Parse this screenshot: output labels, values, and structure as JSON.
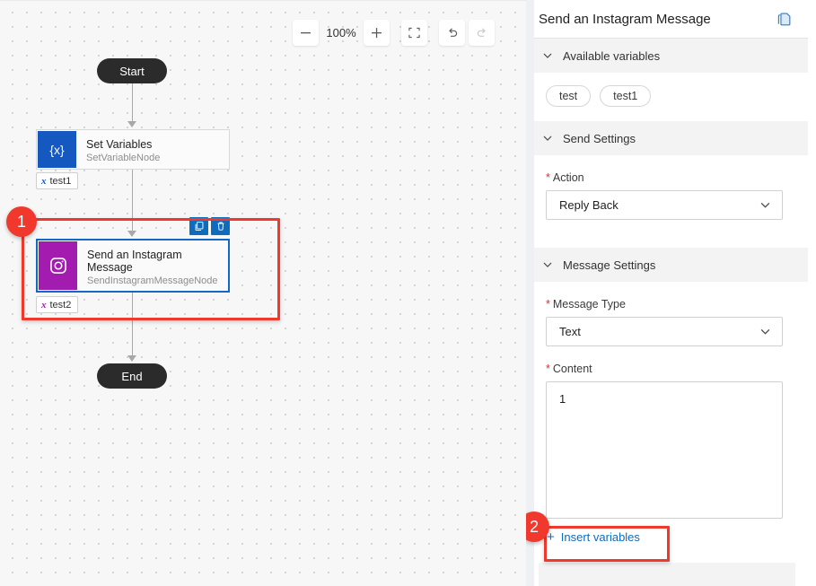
{
  "canvas": {
    "toolbar": {
      "zoom_out_icon": "minus-icon",
      "zoom_level": "100%",
      "zoom_in_icon": "plus-icon",
      "fit_icon": "fit-to-screen-icon",
      "undo_icon": "undo-icon",
      "redo_icon": "redo-icon"
    },
    "nodes": {
      "start": {
        "label": "Start"
      },
      "set_variables": {
        "title": "Set Variables",
        "subtitle": "SetVariableNode",
        "icon": "{x}",
        "icon_name": "set-variable-icon",
        "color": "#1558c0"
      },
      "instagram": {
        "title": "Send an Instagram Message",
        "subtitle": "SendInstagramMessageNode",
        "icon_name": "instagram-icon",
        "color": "#a21caf"
      },
      "end": {
        "label": "End"
      }
    },
    "variable_chips": [
      {
        "label": "test1",
        "marker": "x",
        "color": "#1558c0"
      },
      {
        "label": "test2",
        "marker": "x",
        "color": "#a21caf"
      }
    ],
    "node_actions": {
      "copy_icon": "copy-icon",
      "delete_icon": "delete-icon"
    }
  },
  "annotations": [
    {
      "number": "1"
    },
    {
      "number": "2"
    }
  ],
  "panel": {
    "title": "Send an Instagram Message",
    "header_icon": "panel-pages-icon",
    "sections": {
      "available_variables": {
        "label": "Available variables",
        "chips": [
          "test",
          "test1"
        ]
      },
      "send_settings": {
        "label": "Send Settings",
        "action": {
          "label": "Action",
          "required": true,
          "value": "Reply Back"
        }
      },
      "message_settings": {
        "label": "Message Settings",
        "message_type": {
          "label": "Message Type",
          "required": true,
          "value": "Text"
        },
        "content": {
          "label": "Content",
          "required": true,
          "value": "1"
        },
        "insert_variables": {
          "label": "Insert variables",
          "plus": "+"
        }
      }
    }
  },
  "colors": {
    "accent_blue": "#0f6cbd",
    "annotation_red": "#f1382d",
    "instagram_purple": "#a21caf",
    "node_blue": "#1558c0"
  }
}
